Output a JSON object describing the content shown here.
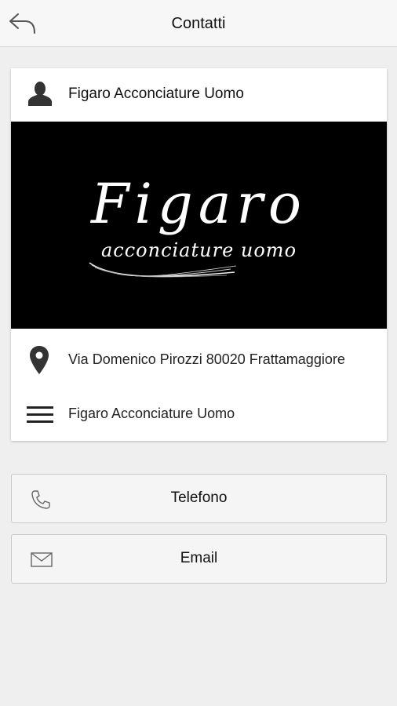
{
  "header": {
    "title": "Contatti",
    "back_icon": "back-arrow-icon"
  },
  "card": {
    "name": "Figaro Acconciature Uomo",
    "name_icon": "person-icon",
    "logo": {
      "title": "Figaro",
      "subtitle": "acconciature uomo"
    },
    "address": "Via Domenico Pirozzi 80020 Frattamaggiore",
    "address_icon": "map-pin-icon",
    "description": "Figaro Acconciature Uomo",
    "description_icon": "menu-lines-icon"
  },
  "actions": {
    "phone_label": "Telefono",
    "phone_icon": "phone-icon",
    "email_label": "Email",
    "email_icon": "envelope-icon"
  },
  "colors": {
    "background": "#efefef",
    "card": "#ffffff",
    "logo_background": "#000000"
  }
}
